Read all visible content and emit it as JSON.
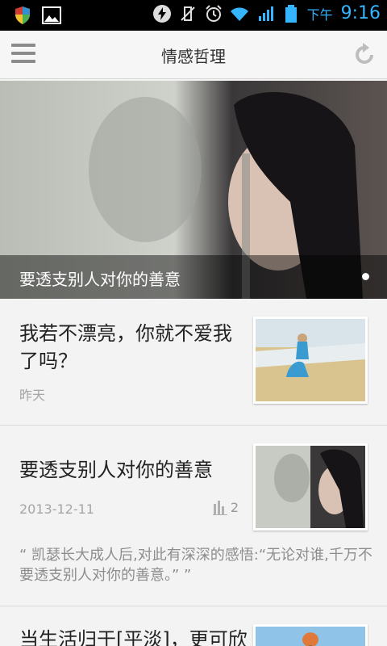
{
  "status_bar": {
    "ampm": "下午",
    "time": "9:16",
    "icons": [
      "shield-icon",
      "gallery-icon",
      "flash-icon",
      "vibrate-off-icon",
      "alarm-icon",
      "wifi-icon",
      "signal-icon",
      "battery-icon"
    ]
  },
  "header": {
    "title": "情感哲理"
  },
  "hero": {
    "caption": "要透支别人对你的善意"
  },
  "articles": [
    {
      "title": "我若不漂亮，你就不爱我了吗？",
      "date": "昨天"
    },
    {
      "title": "要透支别人对你的善意",
      "date": "2013-12-11",
      "count": "2",
      "excerpt": "“ 凯瑟长大成人后,对此有深深的感悟:“无论对谁,千万不要透支别人对你的善意。” ”"
    },
    {
      "title": "当生活归于[平淡]，更可欣"
    }
  ]
}
